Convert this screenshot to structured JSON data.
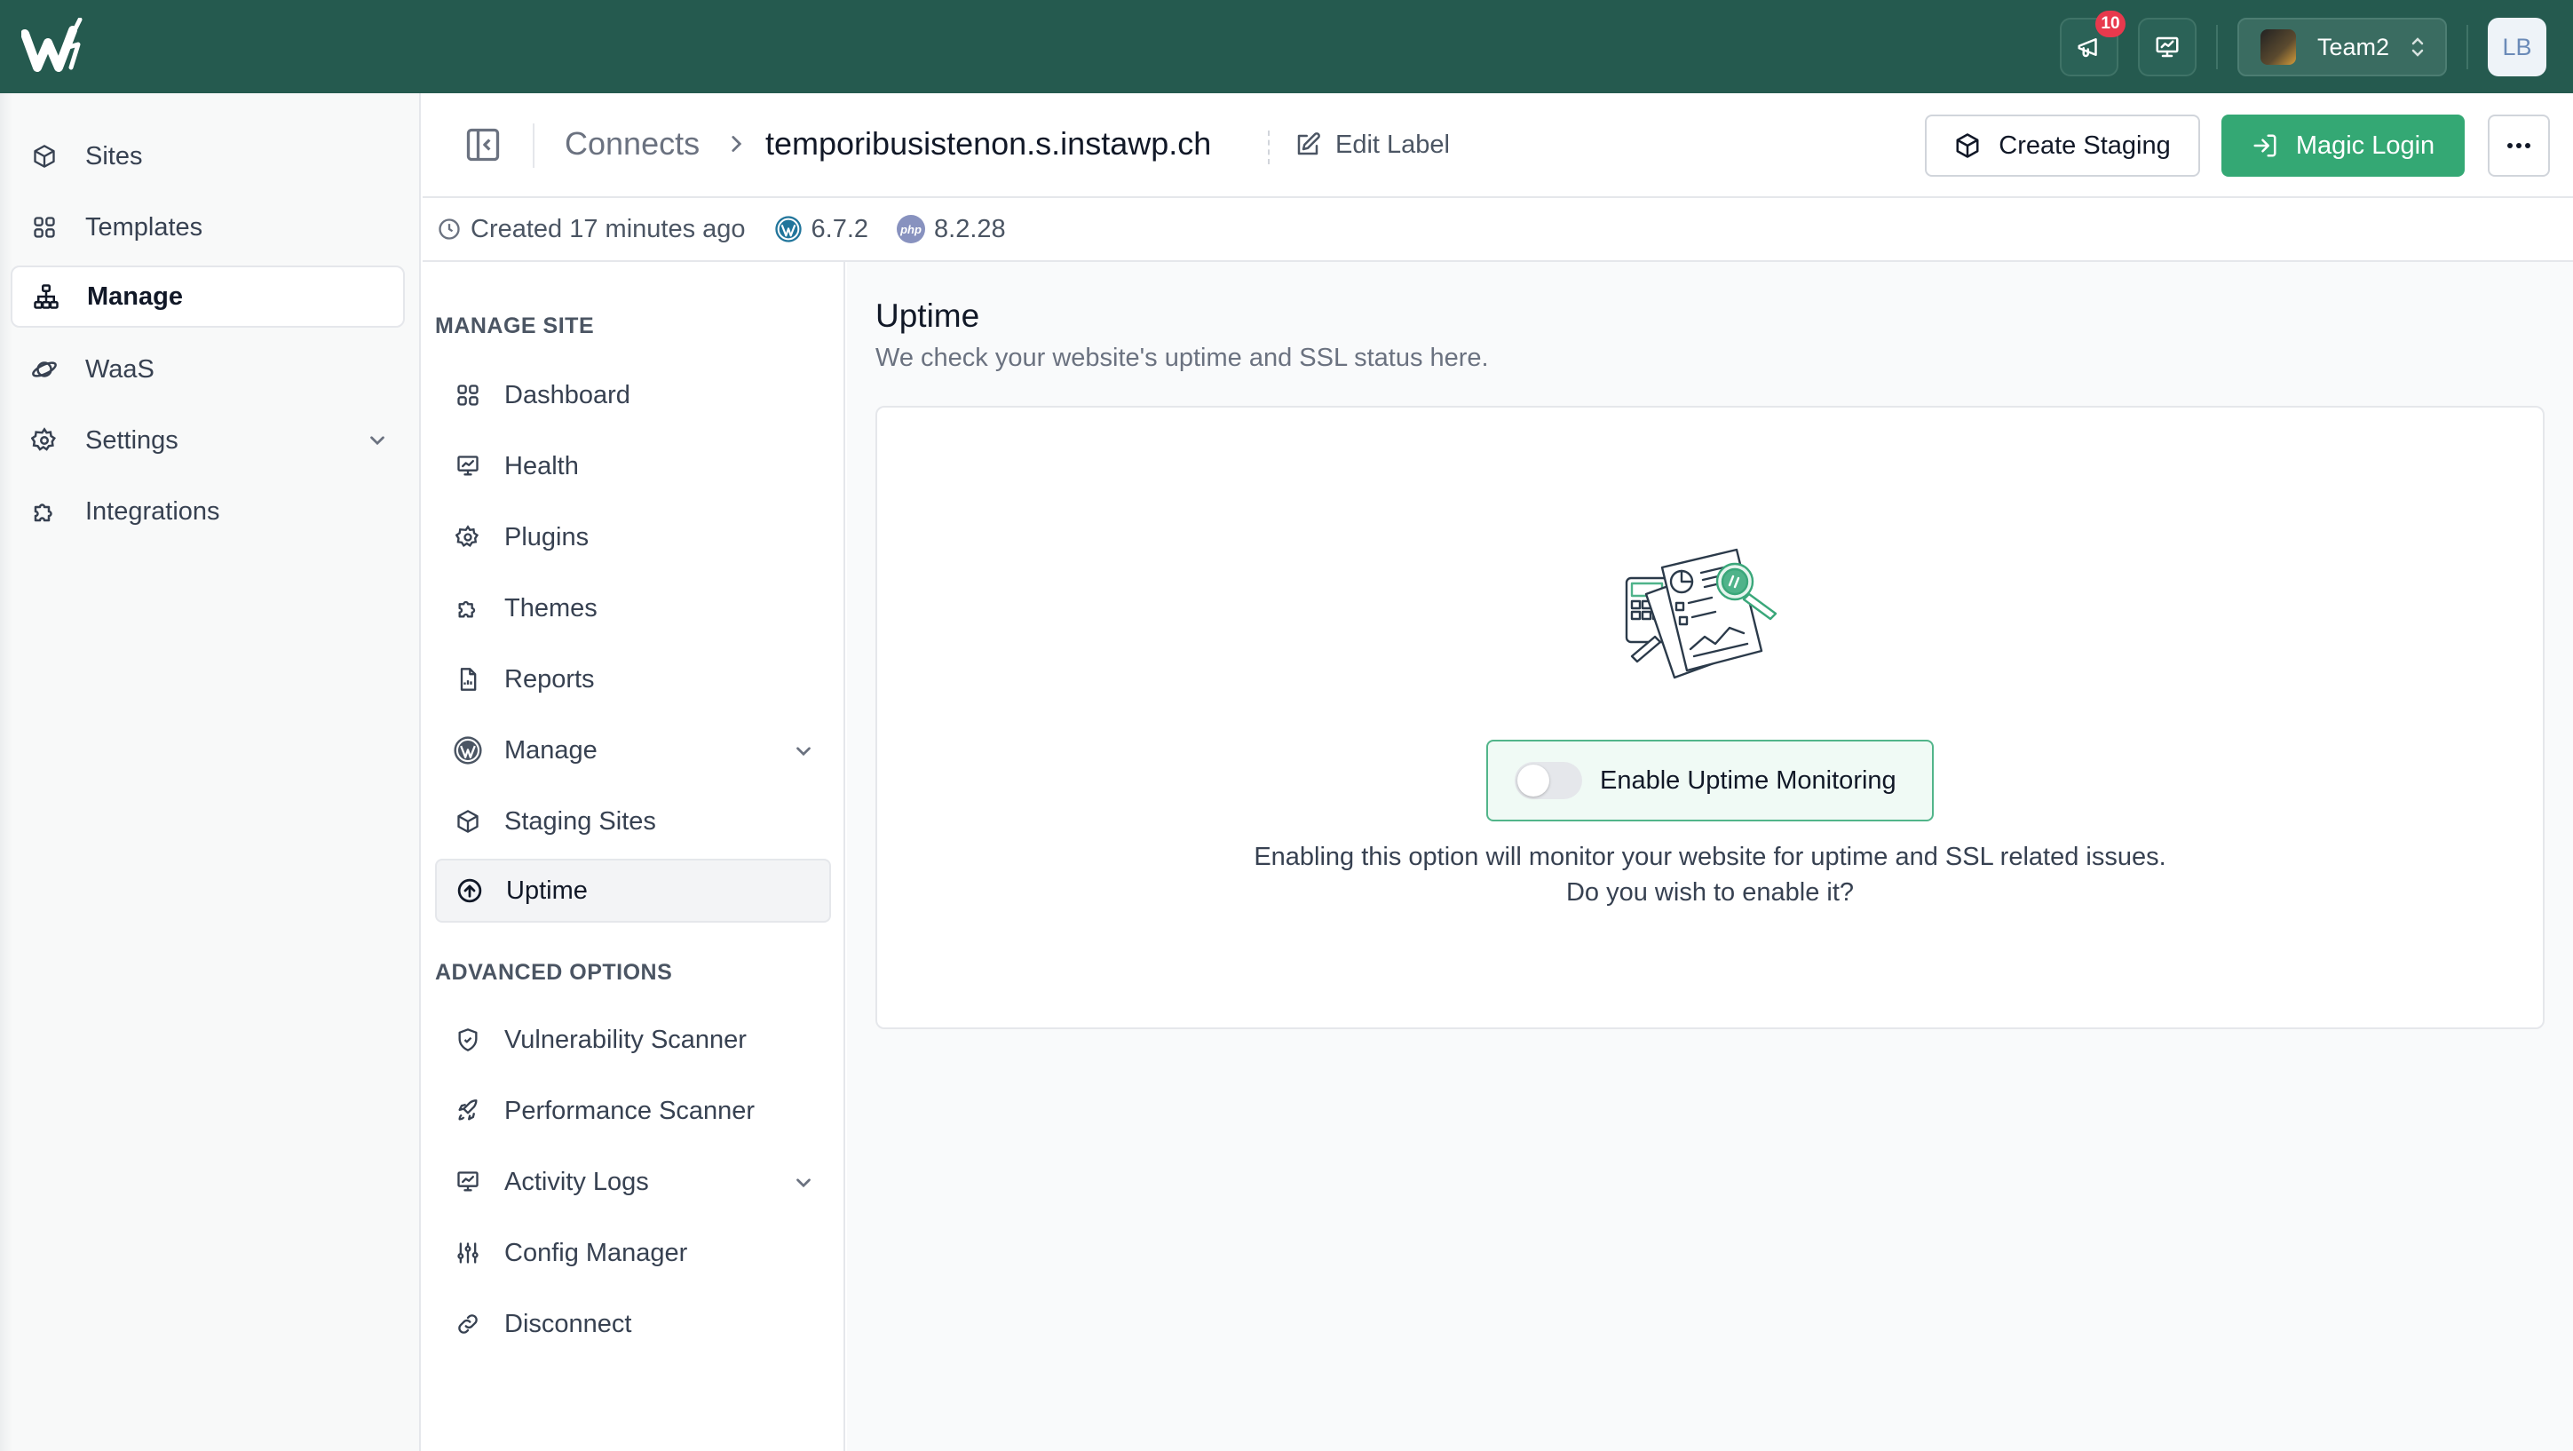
{
  "topbar": {
    "notifications_count": "10",
    "team_name": "Team2",
    "user_initials": "LB",
    "colors": {
      "background": "#255a4f",
      "badge": "#e8394d"
    }
  },
  "sidebar": {
    "items": [
      {
        "label": "Sites",
        "icon": "cube-icon"
      },
      {
        "label": "Templates",
        "icon": "grid-icon"
      },
      {
        "label": "Manage",
        "icon": "sitemap-icon",
        "active": true
      },
      {
        "label": "WaaS",
        "icon": "planet-icon"
      },
      {
        "label": "Settings",
        "icon": "gear-icon",
        "expandable": true
      },
      {
        "label": "Integrations",
        "icon": "puzzle-icon"
      }
    ]
  },
  "header": {
    "breadcrumb_root": "Connects",
    "site_name": "temporibusistenon.s.instawp.ch",
    "edit_label": "Edit Label",
    "create_staging": "Create Staging",
    "magic_login": "Magic Login",
    "colors": {
      "primary": "#34a874"
    }
  },
  "meta": {
    "created": "Created 17 minutes ago",
    "wp_version": "6.7.2",
    "php_version": "8.2.28",
    "php_icon_text": "php"
  },
  "subnav": {
    "manage_site_title": "MANAGE SITE",
    "manage_items": [
      {
        "label": "Dashboard",
        "icon": "grid-icon"
      },
      {
        "label": "Health",
        "icon": "monitor-icon"
      },
      {
        "label": "Plugins",
        "icon": "gear-icon"
      },
      {
        "label": "Themes",
        "icon": "puzzle-icon"
      },
      {
        "label": "Reports",
        "icon": "file-icon"
      },
      {
        "label": "Manage",
        "icon": "wordpress-icon",
        "expandable": true
      },
      {
        "label": "Staging Sites",
        "icon": "cube-icon"
      },
      {
        "label": "Uptime",
        "icon": "arrow-up-circle-icon",
        "active": true
      }
    ],
    "advanced_title": "ADVANCED OPTIONS",
    "advanced_items": [
      {
        "label": "Vulnerability Scanner",
        "icon": "shield-icon"
      },
      {
        "label": "Performance Scanner",
        "icon": "rocket-icon"
      },
      {
        "label": "Activity Logs",
        "icon": "monitor-icon",
        "expandable": true
      },
      {
        "label": "Config Manager",
        "icon": "sliders-icon"
      },
      {
        "label": "Disconnect",
        "icon": "link-icon"
      }
    ]
  },
  "main": {
    "title": "Uptime",
    "subtitle": "We check your website's uptime and SSL status here.",
    "toggle_label": "Enable Uptime Monitoring",
    "toggle_on": false,
    "description_line1": "Enabling this option will monitor your website for uptime and SSL related issues.",
    "description_line2": "Do you wish to enable it?"
  }
}
